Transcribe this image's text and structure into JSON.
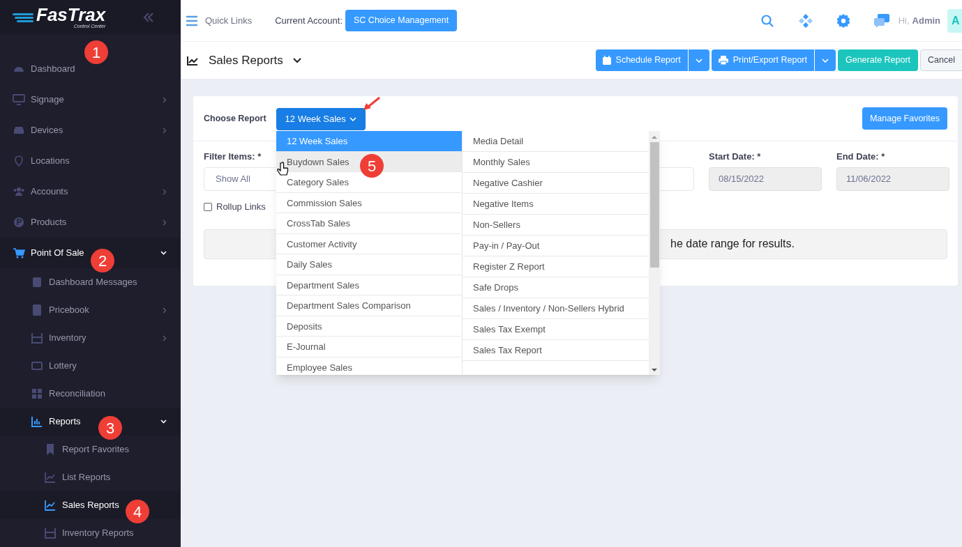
{
  "logo": {
    "name": "FasTrax",
    "subtitle": "Control Center"
  },
  "sidebar": {
    "items": [
      {
        "label": "Dashboard",
        "expandable": false,
        "expanded": false,
        "selected": false
      },
      {
        "label": "Signage",
        "expandable": true,
        "expanded": false,
        "selected": false
      },
      {
        "label": "Devices",
        "expandable": true,
        "expanded": false,
        "selected": false
      },
      {
        "label": "Locations",
        "expandable": false,
        "expanded": false,
        "selected": false
      },
      {
        "label": "Accounts",
        "expandable": true,
        "expanded": false,
        "selected": false
      },
      {
        "label": "Products",
        "expandable": true,
        "expanded": false,
        "selected": false
      },
      {
        "label": "Point Of Sale",
        "expandable": true,
        "expanded": true,
        "selected": true,
        "children": [
          {
            "label": "Dashboard Messages",
            "expandable": false,
            "expanded": false,
            "selected": false
          },
          {
            "label": "Pricebook",
            "expandable": true,
            "expanded": false,
            "selected": false
          },
          {
            "label": "Inventory",
            "expandable": true,
            "expanded": false,
            "selected": false
          },
          {
            "label": "Lottery",
            "expandable": false,
            "expanded": false,
            "selected": false
          },
          {
            "label": "Reconciliation",
            "expandable": false,
            "expanded": false,
            "selected": false
          },
          {
            "label": "Reports",
            "expandable": true,
            "expanded": true,
            "selected": true,
            "children": [
              {
                "label": "Report Favorites",
                "expandable": false,
                "expanded": false,
                "selected": false
              },
              {
                "label": "List Reports",
                "expandable": false,
                "expanded": false,
                "selected": false
              },
              {
                "label": "Sales Reports",
                "expandable": false,
                "expanded": false,
                "selected": true
              },
              {
                "label": "Inventory Reports",
                "expandable": false,
                "expanded": false,
                "selected": false
              }
            ]
          }
        ]
      }
    ]
  },
  "topbar": {
    "quick_links": "Quick Links",
    "account_label": "Current Account:",
    "account": "SC Choice Management",
    "greeting": "Hi,",
    "user": "Admin",
    "avatar": "A"
  },
  "page": {
    "title": "Sales Reports",
    "buttons": [
      {
        "kind": "split",
        "label": "Schedule Report"
      },
      {
        "kind": "split",
        "label": "Print/Export Report"
      },
      {
        "kind": "primary",
        "label": "Generate Report"
      },
      {
        "kind": "plain",
        "label": "Cancel"
      }
    ]
  },
  "form": {
    "choose_label": "Choose Report",
    "report": "12 Week Sales",
    "manage_favorites": "Manage Favorites",
    "filter_label": "Filter Items: *",
    "filter_value": "Show All",
    "start_label": "Start Date: *",
    "start_value": "08/15/2022",
    "end_label": "End Date: *",
    "end_value": "11/06/2022",
    "rollup_label": "Rollup Links",
    "rollup_checked": false,
    "message": "he date range for results."
  },
  "dropdown": {
    "columns": [
      [
        {
          "label": "12 Week Sales",
          "selected": true,
          "hovered": false
        },
        {
          "label": "Buydown Sales",
          "selected": false,
          "hovered": true
        },
        {
          "label": "Category Sales",
          "selected": false,
          "hovered": false
        },
        {
          "label": "Commission Sales",
          "selected": false,
          "hovered": false
        },
        {
          "label": "CrossTab Sales",
          "selected": false,
          "hovered": false
        },
        {
          "label": "Customer Activity",
          "selected": false,
          "hovered": false
        },
        {
          "label": "Daily Sales",
          "selected": false,
          "hovered": false
        },
        {
          "label": "Department Sales",
          "selected": false,
          "hovered": false
        },
        {
          "label": "Department Sales Comparison",
          "selected": false,
          "hovered": false
        },
        {
          "label": "Deposits",
          "selected": false,
          "hovered": false
        },
        {
          "label": "E-Journal",
          "selected": false,
          "hovered": false
        },
        {
          "label": "Employee Sales",
          "selected": false,
          "hovered": false
        }
      ],
      [
        {
          "label": "Media Detail",
          "selected": false,
          "hovered": false
        },
        {
          "label": "Monthly Sales",
          "selected": false,
          "hovered": false
        },
        {
          "label": "Negative Cashier",
          "selected": false,
          "hovered": false
        },
        {
          "label": "Negative Items",
          "selected": false,
          "hovered": false
        },
        {
          "label": "Non-Sellers",
          "selected": false,
          "hovered": false
        },
        {
          "label": "Pay-in / Pay-Out",
          "selected": false,
          "hovered": false
        },
        {
          "label": "Register Z Report",
          "selected": false,
          "hovered": false
        },
        {
          "label": "Safe Drops",
          "selected": false,
          "hovered": false
        },
        {
          "label": "Sales / Inventory / Non-Sellers Hybrid",
          "selected": false,
          "hovered": false
        },
        {
          "label": "Sales Tax Exempt",
          "selected": false,
          "hovered": false
        },
        {
          "label": "Sales Tax Report",
          "selected": false,
          "hovered": false
        }
      ]
    ]
  },
  "annotations": [
    "1",
    "2",
    "3",
    "4",
    "5"
  ]
}
